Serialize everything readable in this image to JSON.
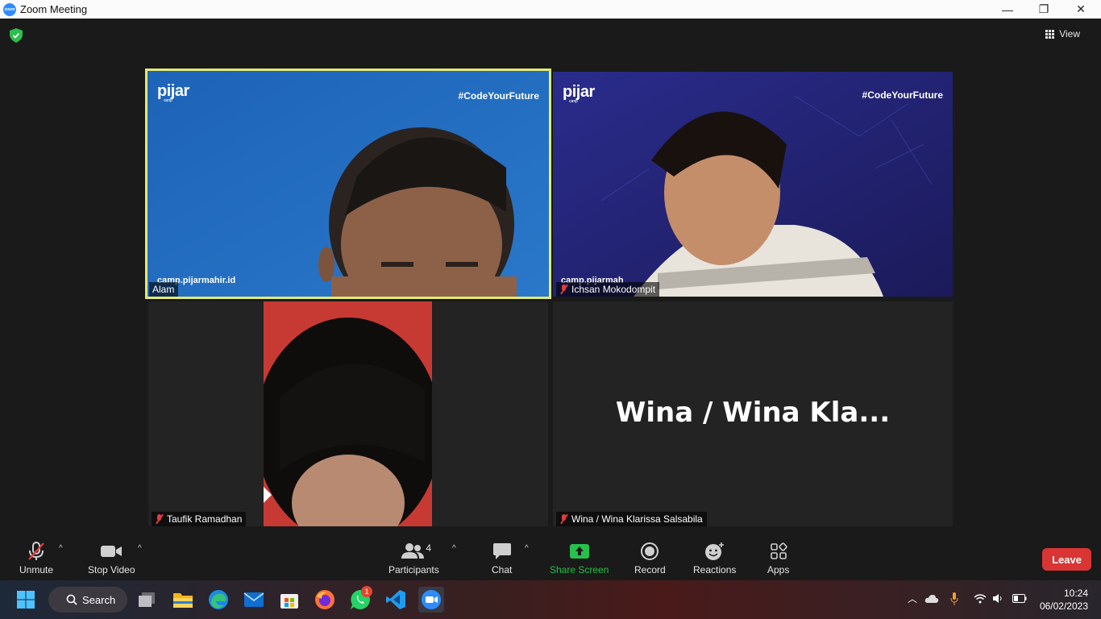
{
  "window": {
    "title": "Zoom Meeting",
    "app_icon_text": "zoom",
    "minimize": "—",
    "restore": "❐",
    "close": "✕"
  },
  "meeting": {
    "view_label": "View",
    "security_color": "#2dbe4d",
    "participants": [
      {
        "name": "Alam",
        "muted": false,
        "active_speaker": true,
        "brand": "pijar",
        "brand_sub": "camp",
        "hashtag": "#CodeYourFuture",
        "site": "camp.pijarmahir.id"
      },
      {
        "name": "Ichsan Mokodompit",
        "muted": true,
        "brand": "pijar",
        "brand_sub": "camp",
        "hashtag": "#CodeYourFuture",
        "site": "camp.pijarmah"
      },
      {
        "name": "Taufik Ramadhan",
        "muted": true
      },
      {
        "name": "Wina / Wina Klarissa Salsabila",
        "muted": true,
        "placeholder_name": "Wina / Wina Kla..."
      }
    ]
  },
  "toolbar": {
    "unmute": "Unmute",
    "stop_video": "Stop Video",
    "participants": "Participants",
    "participants_count": "4",
    "chat": "Chat",
    "share_screen": "Share Screen",
    "record": "Record",
    "reactions": "Reactions",
    "apps": "Apps",
    "leave": "Leave",
    "caret": "^",
    "accent_green": "#27c04b",
    "leave_color": "#d93535"
  },
  "taskbar": {
    "search_label": "Search",
    "whatsapp_badge": "1",
    "time": "10:24",
    "date": "06/02/2023",
    "apps": [
      "start-icon",
      "search-icon",
      "task-view-icon",
      "file-explorer-icon",
      "edge-icon",
      "mail-icon",
      "store-icon",
      "firefox-icon",
      "whatsapp-icon",
      "vscode-icon",
      "zoom-icon"
    ]
  }
}
